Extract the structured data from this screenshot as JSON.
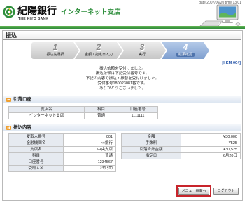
{
  "header": {
    "datetime": "date:2007/06/20 time 13:01",
    "bank_name": "紀陽銀行",
    "branch_name": "インターネット支店",
    "bank_name_en": "THE KIYO BANK",
    "logo_icon": "kiyo-bank-logo-icon",
    "illustration_icon": "computer-icon"
  },
  "page": {
    "title": "振込",
    "screen_id": "[I-KM-004]"
  },
  "steps": [
    {
      "number": "1",
      "label": "振込先選択",
      "current": false
    },
    {
      "number": "2",
      "label": "金額・指定日入力",
      "current": false
    },
    {
      "number": "3",
      "label": "実行",
      "current": false
    },
    {
      "number": "4",
      "label": "結果確認",
      "current": true
    }
  ],
  "message": {
    "lines": [
      "振込依頼を受付けました。",
      "振込依頼は下記受付番号です。",
      "下記の内容で振込・振替を受付けました。",
      "受付番号180023081番です。",
      "ありがとうございました。"
    ]
  },
  "debit_account": {
    "title": "引落口座",
    "icon": "account-icon",
    "columns": [
      "支店名",
      "科目",
      "口座番号"
    ],
    "row": [
      "インターネット支店",
      "普通",
      "1111111"
    ]
  },
  "transfer": {
    "title": "振込内容",
    "icon": "transfer-icon",
    "payee": [
      {
        "label": "受取人番号",
        "value": "001"
      },
      {
        "label": "金融機関名",
        "value": "××銀行"
      },
      {
        "label": "支店名",
        "value": "中央支店"
      },
      {
        "label": "科目",
        "value": "普通"
      },
      {
        "label": "口座番号",
        "value": "1234567"
      },
      {
        "label": "受取人名",
        "value": "ｷﾖｳ ﾀﾛｳ"
      }
    ],
    "amounts": [
      {
        "label": "金額",
        "value": "¥30,000"
      },
      {
        "label": "手数料",
        "value": "¥525"
      },
      {
        "label": "引落合計金額",
        "value": "¥30,525"
      },
      {
        "label": "指定日",
        "value": "6月20日"
      }
    ]
  },
  "actions": {
    "menu_label": "メニュー画面へ",
    "logout_label": "ログアウト"
  },
  "colors": {
    "brand_green": "#2f8f3d",
    "step_current": "#7f9fcf",
    "highlight": "#c8242b",
    "link_blue": "#1f4fa5"
  }
}
